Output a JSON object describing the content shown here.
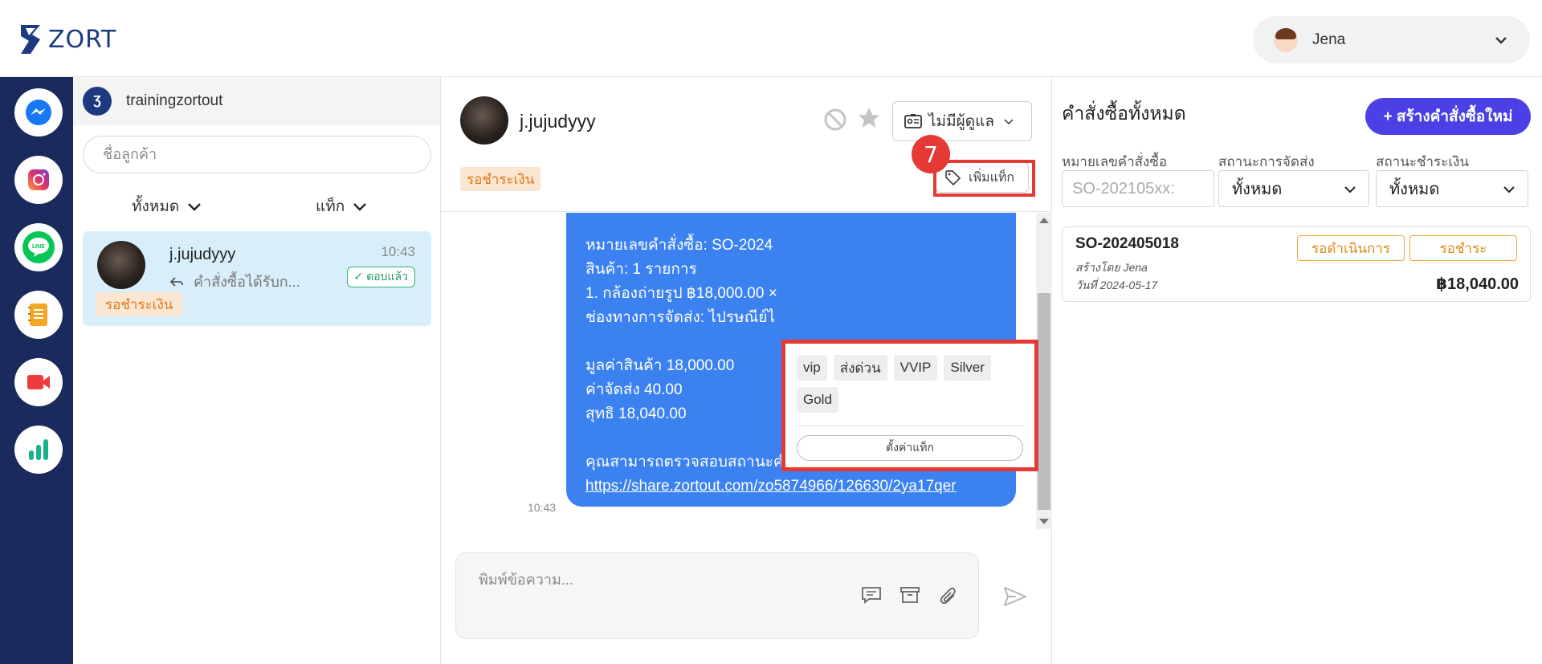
{
  "app": {
    "logo_text": "ZORT"
  },
  "user": {
    "name": "Jena"
  },
  "apps": [
    "messenger-icon",
    "instagram-icon",
    "line-icon",
    "notebook-icon",
    "video-icon",
    "chart-icon"
  ],
  "sidebar": {
    "shop_logo": "Ʒ",
    "shop_name": "trainingzortout",
    "search_placeholder": "ชื่อลูกค้า",
    "filter_all": "ทั้งหมด",
    "filter_tag": "แท็ก"
  },
  "conversation": {
    "name": "j.jujudyyy",
    "time": "10:43",
    "preview": "คำสั่งซื้อได้รับก...",
    "replied_badge": "✓ ตอบแล้ว",
    "status": "รอชำระเงิน"
  },
  "chat": {
    "name": "j.jujudyyy",
    "assign_label": "ไม่มีผู้ดูแล",
    "status_tag": "รอชำระเงิน",
    "add_tag_label": "เพิ่มแท็ก",
    "step_number": "7",
    "message_lines": [
      "หมายเลขคำสั่งซื้อ: SO-2024",
      "สินค้า: 1 รายการ",
      "1. กล้องถ่ายรูป ฿18,000.00 ×",
      "ช่องทางการจัดส่ง: ไปรษณีย์ไ"
    ],
    "summary_lines": [
      "มูลค่าสินค้า 18,000.00",
      "ค่าจัดส่ง 40.00",
      "สุทธิ 18,040.00"
    ],
    "check_text": "คุณสามารถตรวจสอบสถานะคำสั่งซื้อและชำระเงินได้ที่",
    "link": "https://share.zortout.com/zo5874966/126630/2ya17qer",
    "message_time": "10:43",
    "composer_placeholder": "พิมพ์ข้อความ..."
  },
  "tag_popup": {
    "tags": [
      "vip",
      "ส่งด่วน",
      "VVIP",
      "Silver",
      "Gold"
    ],
    "settings_label": "ตั้งค่าแท็ก"
  },
  "orders": {
    "title": "คำสั่งซื้อทั้งหมด",
    "create_label": "+ สร้างคำสั่งซื้อใหม่",
    "order_no_label": "หมายเลขคำสั่งซื้อ",
    "order_no_placeholder": "SO-202105xx:",
    "shipping_label": "สถานะการจัดส่ง",
    "shipping_value": "ทั้งหมด",
    "payment_label": "สถานะชำระเงิน",
    "payment_value": "ทั้งหมด",
    "order": {
      "id": "SO-202405018",
      "created_by": "สร้างโดย Jena",
      "date": "วันที่ 2024-05-17",
      "badge_process": "รอดำเนินการ",
      "badge_payment": "รอชำระ",
      "total": "฿18,040.00"
    }
  },
  "colors": {
    "appbar": "#1b2a5c",
    "bubble": "#3b82f0",
    "primary_button": "#4b40e6",
    "highlight": "#e53935",
    "status_orange": "#e07a1a"
  }
}
